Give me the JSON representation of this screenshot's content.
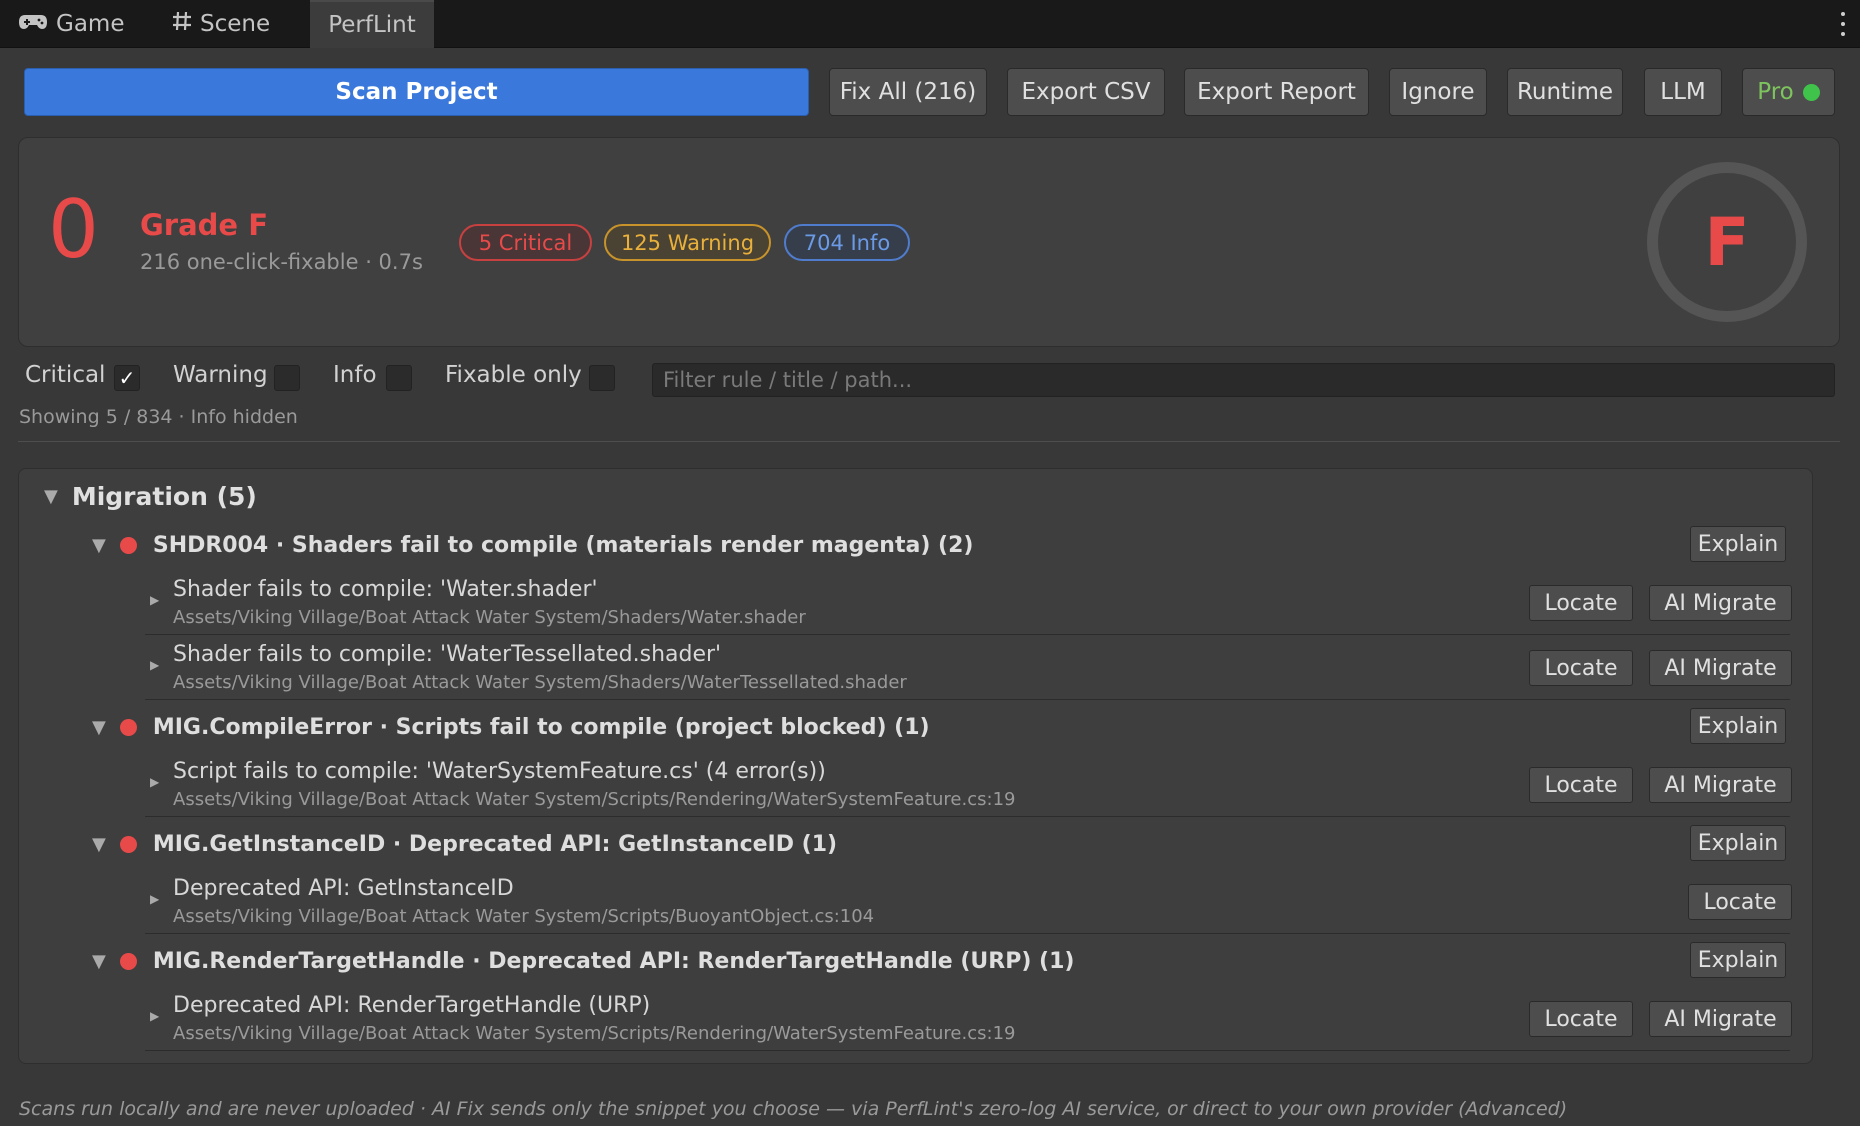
{
  "tabs": {
    "game": "Game",
    "scene": "Scene",
    "perflint": "PerfLint"
  },
  "toolbar": {
    "scan": "Scan Project",
    "fix_all": "Fix All (216)",
    "export_csv": "Export CSV",
    "export_report": "Export Report",
    "ignore": "Ignore",
    "runtime": "Runtime",
    "llm": "LLM",
    "pro": "Pro"
  },
  "summary": {
    "score": "0",
    "grade": "Grade F",
    "subtitle": "216 one-click-fixable · 0.7s",
    "critical": "5 Critical",
    "warning": "125 Warning",
    "info": "704 Info",
    "grade_letter": "F"
  },
  "filters": {
    "critical": {
      "label": "Critical",
      "checked": true
    },
    "warning": {
      "label": "Warning",
      "checked": false
    },
    "info": {
      "label": "Info",
      "checked": false
    },
    "fixable": {
      "label": "Fixable only",
      "checked": false
    },
    "search_placeholder": "Filter rule / title / path...",
    "showing": "Showing 5 / 834 · Info hidden"
  },
  "group": {
    "title": "Migration (5)"
  },
  "rules": [
    {
      "title": "SHDR004 · Shaders fail to compile (materials render magenta) (2)",
      "explain": "Explain",
      "issues": [
        {
          "title": "Shader fails to compile: 'Water.shader'",
          "path": "Assets/Viking Village/Boat Attack Water System/Shaders/Water.shader",
          "locate": "Locate",
          "migrate": "AI Migrate"
        },
        {
          "title": "Shader fails to compile: 'WaterTessellated.shader'",
          "path": "Assets/Viking Village/Boat Attack Water System/Shaders/WaterTessellated.shader",
          "locate": "Locate",
          "migrate": "AI Migrate"
        }
      ]
    },
    {
      "title": "MIG.CompileError · Scripts fail to compile (project blocked) (1)",
      "explain": "Explain",
      "issues": [
        {
          "title": "Script fails to compile: 'WaterSystemFeature.cs' (4 error(s))",
          "path": "Assets/Viking Village/Boat Attack Water System/Scripts/Rendering/WaterSystemFeature.cs:19",
          "locate": "Locate",
          "migrate": "AI Migrate"
        }
      ]
    },
    {
      "title": "MIG.GetInstanceID · Deprecated API: GetInstanceID (1)",
      "explain": "Explain",
      "issues": [
        {
          "title": "Deprecated API: GetInstanceID",
          "path": "Assets/Viking Village/Boat Attack Water System/Scripts/BuoyantObject.cs:104",
          "locate": "Locate"
        }
      ]
    },
    {
      "title": "MIG.RenderTargetHandle · Deprecated API: RenderTargetHandle (URP) (1)",
      "explain": "Explain",
      "issues": [
        {
          "title": "Deprecated API: RenderTargetHandle (URP)",
          "path": "Assets/Viking Village/Boat Attack Water System/Scripts/Rendering/WaterSystemFeature.cs:19",
          "locate": "Locate",
          "migrate": "AI Migrate"
        }
      ]
    }
  ],
  "footer": "Scans run locally and are never uploaded · AI Fix sends only the snippet you choose — via PerfLint's zero-log AI service, or direct to your own provider (Advanced)"
}
